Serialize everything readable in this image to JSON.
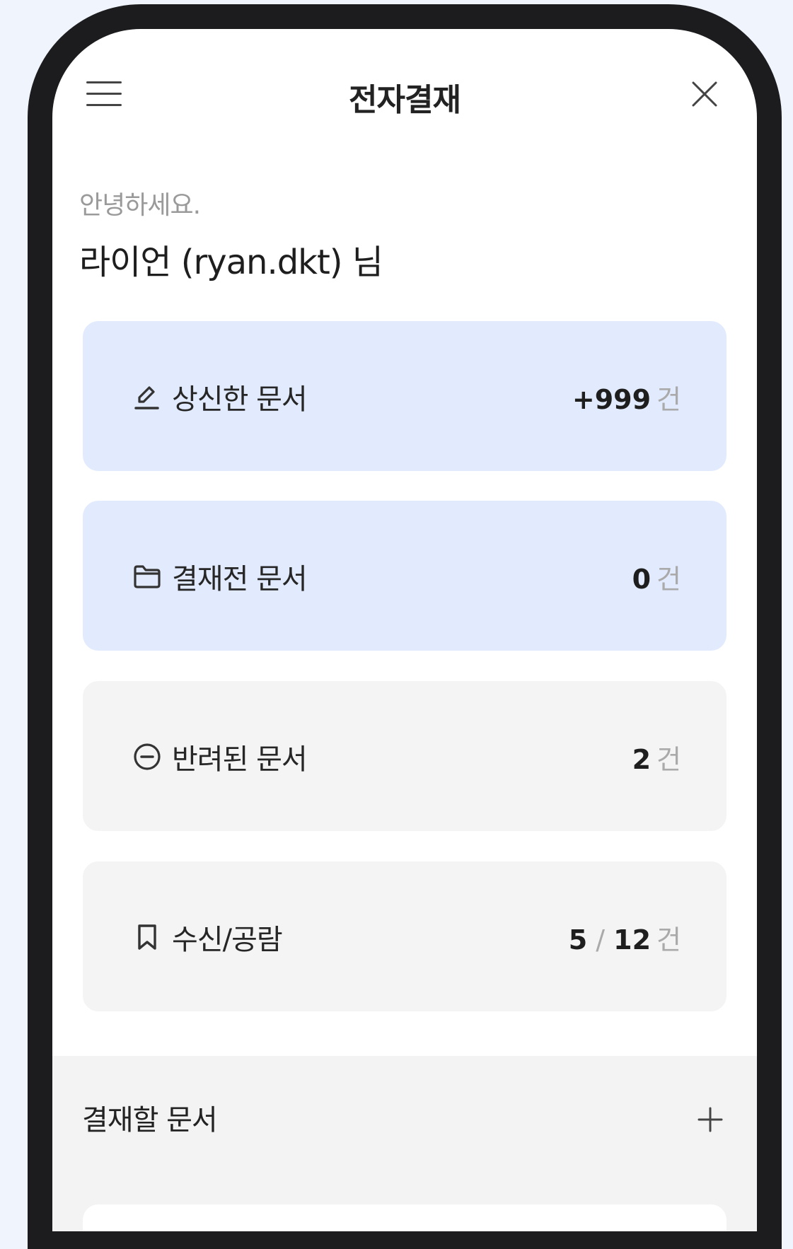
{
  "app": {
    "title": "전자결재",
    "menu_icon": "hamburger-menu-icon",
    "close_icon": "close-icon"
  },
  "greeting": {
    "hello": "안녕하세요.",
    "user": "라이언 (ryan.dkt) 님"
  },
  "cards": [
    {
      "label": "상신한 문서",
      "icon": "pen-icon",
      "count": "+999",
      "unit": "건"
    },
    {
      "label": "결재전 문서",
      "icon": "folder-icon",
      "count": "0",
      "unit": "건"
    },
    {
      "label": "반려된 문서",
      "icon": "minus-circle-icon",
      "count": "2",
      "unit": "건"
    },
    {
      "label": "수신/공람",
      "icon": "bookmark-icon",
      "count": "5",
      "separator": "/",
      "total": "12",
      "unit": "건"
    }
  ],
  "section": {
    "title": "결재할 문서",
    "add_icon": "plus-icon"
  },
  "colors": {
    "bezel": "#1c1c1e",
    "card_active": "#e2ebfd",
    "card_inactive": "#f4f4f4",
    "section_bg": "#f3f3f3",
    "page_bg": "#f0f4fd"
  }
}
